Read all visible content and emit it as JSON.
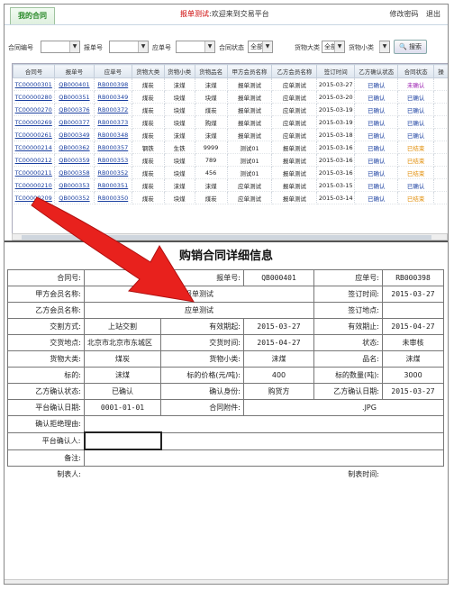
{
  "topbar": {
    "tab_label": "我的合同",
    "welcome_name": "报单测试",
    "welcome_text": ":欢迎来到交易平台",
    "change_password": "修改密码",
    "logout": "退出"
  },
  "filters": {
    "contract_no_label": "合同编号",
    "order_no_label": "报单号",
    "stock_no_label": "应单号",
    "status_label": "合同状态",
    "status_value": "全部",
    "category_label": "货物大类",
    "category_value": "全部",
    "subcategory_label": "货物小类",
    "search_label": "搜索"
  },
  "grid": {
    "columns": [
      "合同号",
      "报单号",
      "应单号",
      "货物大类",
      "货物小类",
      "货物品名",
      "甲方会员名称",
      "乙方会员名称",
      "签订时间",
      "乙方确认状态",
      "合同状态"
    ],
    "rows": [
      [
        "TC00000301",
        "QB000401",
        "RB000398",
        "煤炭",
        "沫煤",
        "沫煤",
        "报单测试",
        "应单测试",
        "2015-03-27",
        "已确认",
        "未确认"
      ],
      [
        "TC00000280",
        "QB000351",
        "RB000349",
        "煤炭",
        "块煤",
        "块煤",
        "报单测试",
        "应单测试",
        "2015-03-20",
        "已确认",
        "已确认"
      ],
      [
        "TC00000270",
        "QB000376",
        "RB000372",
        "煤炭",
        "块煤",
        "煤炭",
        "报单测试",
        "应单测试",
        "2015-03-19",
        "已确认",
        "已确认"
      ],
      [
        "TC00000269",
        "QB000377",
        "RB000373",
        "煤炭",
        "块煤",
        "购煤",
        "报单测试",
        "应单测试",
        "2015-03-19",
        "已确认",
        "已确认"
      ],
      [
        "TC00000261",
        "QB000349",
        "RB000348",
        "煤炭",
        "沫煤",
        "沫煤",
        "报单测试",
        "应单测试",
        "2015-03-18",
        "已确认",
        "已确认"
      ],
      [
        "TC00000214",
        "QB000362",
        "RB000357",
        "钢铁",
        "生铁",
        "9999",
        "测试01",
        "报单测试",
        "2015-03-16",
        "已确认",
        "已结束"
      ],
      [
        "TC00000212",
        "QB000359",
        "RB000353",
        "煤炭",
        "块煤",
        "789",
        "测试01",
        "报单测试",
        "2015-03-16",
        "已确认",
        "已结束"
      ],
      [
        "TC00000211",
        "QB000358",
        "RB000352",
        "煤炭",
        "块煤",
        "456",
        "测试01",
        "报单测试",
        "2015-03-16",
        "已确认",
        "已结束"
      ],
      [
        "TC00000210",
        "QB000353",
        "RB000351",
        "煤炭",
        "沫煤",
        "沫煤",
        "应单测试",
        "报单测试",
        "2015-03-15",
        "已确认",
        "已确认"
      ],
      [
        "TC00000209",
        "QB000352",
        "RB000350",
        "煤炭",
        "块煤",
        "煤炭",
        "应单测试",
        "报单测试",
        "2015-03-14",
        "已确认",
        "已结束"
      ]
    ]
  },
  "detail": {
    "title": "购销合同详细信息",
    "contract_no_label": "合同号:",
    "contract_no_value": "",
    "order_no_label": "报单号:",
    "order_no_value": "QB000401",
    "stock_no_label": "应单号:",
    "stock_no_value": "RB000398",
    "party_a_label": "甲方会员名称:",
    "party_a_value": "报单测试",
    "sign_time_label": "签订时间:",
    "sign_time_value": "2015-03-27",
    "party_b_label": "乙方会员名称:",
    "party_b_value": "应单测试",
    "sign_place_label": "签订地点:",
    "sign_place_value": "",
    "delivery_method_label": "交割方式:",
    "delivery_method_value": "上站交割",
    "valid_start_label": "有效期起:",
    "valid_start_value": "2015-03-27",
    "valid_end_label": "有效期止:",
    "valid_end_value": "2015-04-27",
    "delivery_place_label": "交货地点:",
    "delivery_place_value": "北京市北京市东城区",
    "delivery_time_label": "交货时间:",
    "delivery_time_value": "2015-04-27",
    "state_label": "状态:",
    "state_value": "未审核",
    "category_label": "货物大类:",
    "category_value": "煤炭",
    "subcategory_label": "货物小类:",
    "subcategory_value": "沫煤",
    "product_label": "品名:",
    "product_value": "沫煤",
    "target_label": "标的:",
    "target_value": "沫煤",
    "price_label": "标的价格(元/吨):",
    "price_value": "400",
    "quantity_label": "标的数量(吨):",
    "quantity_value": "3000",
    "b_confirm_state_label": "乙方确认状态:",
    "b_confirm_state_value": "已确认",
    "confirm_identity_label": "确认身份:",
    "confirm_identity_value": "购货方",
    "b_confirm_date_label": "乙方确认日期:",
    "b_confirm_date_value": "2015-03-27",
    "platform_confirm_date_label": "平台确认日期:",
    "platform_confirm_date_value": "0001-01-01",
    "attachment_label": "合同附件:",
    "attachment_value": ".JPG",
    "reject_reason_label": "确认拒绝理由:",
    "platform_confirmer_label": "平台确认人:",
    "remark_label": "备注:",
    "maker_label": "制表人:",
    "make_time_label": "制表时间:"
  },
  "colors": {
    "link": "#1a3fa0",
    "unconfirmed": "#d00000",
    "ended": "#e08a00",
    "arrow": "#e8211d"
  }
}
